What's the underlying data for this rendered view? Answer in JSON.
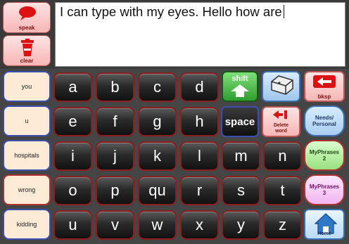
{
  "text_area": {
    "value": "I can type with my eyes. Hello how are"
  },
  "top_buttons": {
    "speak": "speak",
    "clear": "clear"
  },
  "word_keys": [
    "you",
    "u",
    "hospitals",
    "wrong",
    "kidding"
  ],
  "letter_rows": [
    [
      "a",
      "b",
      "c",
      "d"
    ],
    [
      "e",
      "f",
      "g",
      "h"
    ],
    [
      "i",
      "j",
      "k",
      "l",
      "m",
      "n"
    ],
    [
      "o",
      "p",
      "qu",
      "r",
      "s",
      "t"
    ],
    [
      "u",
      "v",
      "w",
      "x",
      "y",
      "z"
    ]
  ],
  "function_keys": {
    "shift": "shift",
    "space": "space",
    "delete_word": [
      "Delete",
      "word"
    ],
    "backspace": "bksp",
    "needs_personal": [
      "Needs/",
      "Personal"
    ],
    "myphrases2": [
      "MyPhrases",
      "2"
    ],
    "myphrases3": [
      "MyPhrases",
      "3"
    ],
    "home": "Home"
  },
  "colors": {
    "letter_border": "#8c1e1e",
    "word_fill": "#fdebd6",
    "accent_blue": "#3b6fb0"
  }
}
